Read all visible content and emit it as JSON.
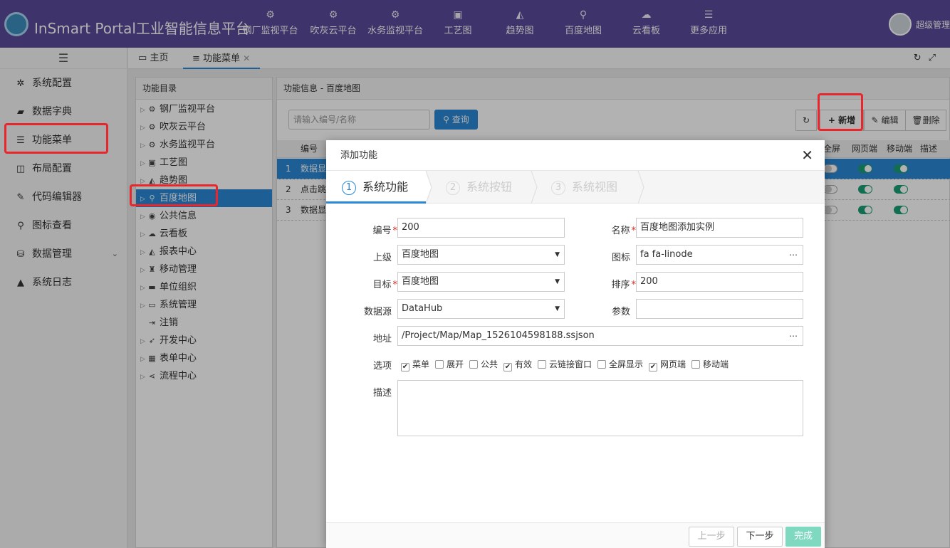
{
  "header": {
    "app_title": "InSmart Portal工业智能信息平台",
    "nav": [
      {
        "label": "钢厂监视平台",
        "icon": "cogs-icon",
        "glyph": "⚙"
      },
      {
        "label": "吹灰云平台",
        "icon": "cogs-icon",
        "glyph": "⚙"
      },
      {
        "label": "水务监视平台",
        "icon": "cogs-icon",
        "glyph": "⚙"
      },
      {
        "label": "工艺图",
        "icon": "image-icon",
        "glyph": "▣"
      },
      {
        "label": "趋势图",
        "icon": "area-chart-icon",
        "glyph": "◭"
      },
      {
        "label": "百度地图",
        "icon": "map-marker-icon",
        "glyph": "⚲"
      },
      {
        "label": "云看板",
        "icon": "cloud-icon",
        "glyph": "☁"
      },
      {
        "label": "更多应用",
        "icon": "bars-icon",
        "glyph": "☰"
      }
    ],
    "user_name": "超级管理"
  },
  "sidebar": {
    "items": [
      {
        "label": "系统配置",
        "icon": "gear-icon",
        "glyph": "✲"
      },
      {
        "label": "数据字典",
        "icon": "book-icon",
        "glyph": "▰"
      },
      {
        "label": "功能菜单",
        "icon": "list-icon",
        "glyph": "☰"
      },
      {
        "label": "布局配置",
        "icon": "columns-icon",
        "glyph": "◫"
      },
      {
        "label": "代码编辑器",
        "icon": "edit-icon",
        "glyph": "✎"
      },
      {
        "label": "图标查看",
        "icon": "search-icon",
        "glyph": "⚲"
      },
      {
        "label": "数据管理",
        "icon": "database-icon",
        "glyph": "⛁"
      },
      {
        "label": "系统日志",
        "icon": "warning-icon",
        "glyph": "▲"
      }
    ],
    "expand_arrow": "⌄"
  },
  "tabs": [
    {
      "label": "主页",
      "glyph": "▭"
    },
    {
      "label": "功能菜单",
      "glyph": "≡"
    }
  ],
  "tree": {
    "title": "功能目录",
    "items": [
      {
        "label": "钢厂监视平台",
        "glyph": "⚙"
      },
      {
        "label": "吹灰云平台",
        "glyph": "⚙"
      },
      {
        "label": "水务监视平台",
        "glyph": "⚙"
      },
      {
        "label": "工艺图",
        "glyph": "▣"
      },
      {
        "label": "趋势图",
        "glyph": "◭"
      },
      {
        "label": "百度地图",
        "glyph": "⚲"
      },
      {
        "label": "公共信息",
        "glyph": "◉"
      },
      {
        "label": "云看板",
        "glyph": "☁"
      },
      {
        "label": "报表中心",
        "glyph": "◭"
      },
      {
        "label": "移动管理",
        "glyph": "♜"
      },
      {
        "label": "单位组织",
        "glyph": "▬"
      },
      {
        "label": "系统管理",
        "glyph": "▭"
      },
      {
        "label": "注销",
        "glyph": "⇥"
      },
      {
        "label": "开发中心",
        "glyph": "➶"
      },
      {
        "label": "表单中心",
        "glyph": "▦"
      },
      {
        "label": "流程中心",
        "glyph": "⋖"
      }
    ]
  },
  "main": {
    "title": "功能信息 - 百度地图",
    "search_placeholder": "请输入编号/名称",
    "query_label": "查询",
    "refresh_glyph": "↻",
    "add_label": "新增",
    "edit_label": "编辑",
    "delete_label": "删除",
    "columns": [
      "编号",
      "全屏",
      "网页端",
      "移动端",
      "描述"
    ],
    "rows": [
      {
        "index": "1",
        "code": "数据显",
        "fullscreen": false,
        "web": true,
        "mobile": true
      },
      {
        "index": "2",
        "code": "点击跳",
        "fullscreen": false,
        "web": true,
        "mobile": true
      },
      {
        "index": "3",
        "code": "数据显",
        "fullscreen": false,
        "web": true,
        "mobile": true
      }
    ]
  },
  "dialog": {
    "title": "添加功能",
    "close_glyph": "✕",
    "steps": [
      {
        "num": "1",
        "label": "系统功能"
      },
      {
        "num": "2",
        "label": "系统按钮"
      },
      {
        "num": "3",
        "label": "系统视图"
      }
    ],
    "fields": {
      "code": {
        "label": "编号",
        "value": "200"
      },
      "name": {
        "label": "名称",
        "value": "百度地图添加实例"
      },
      "parent": {
        "label": "上级",
        "value": "百度地图"
      },
      "icon": {
        "label": "图标",
        "value": "fa fa-linode"
      },
      "target": {
        "label": "目标",
        "value": "百度地图"
      },
      "sort": {
        "label": "排序",
        "value": "200"
      },
      "datasource": {
        "label": "数据源",
        "value": "DataHub"
      },
      "params": {
        "label": "参数",
        "value": ""
      },
      "address": {
        "label": "地址",
        "value": "/Project/Map/Map_1526104598188.ssjson"
      },
      "options_label": "选项",
      "desc_label": "描述"
    },
    "options": [
      {
        "label": "菜单",
        "checked": true
      },
      {
        "label": "展开",
        "checked": false
      },
      {
        "label": "公共",
        "checked": false
      },
      {
        "label": "有效",
        "checked": true
      },
      {
        "label": "云链接窗口",
        "checked": false
      },
      {
        "label": "全屏显示",
        "checked": false
      },
      {
        "label": "网页端",
        "checked": true
      },
      {
        "label": "移动端",
        "checked": false
      }
    ],
    "buttons": {
      "prev": "上一步",
      "next": "下一步",
      "finish": "完成"
    }
  }
}
